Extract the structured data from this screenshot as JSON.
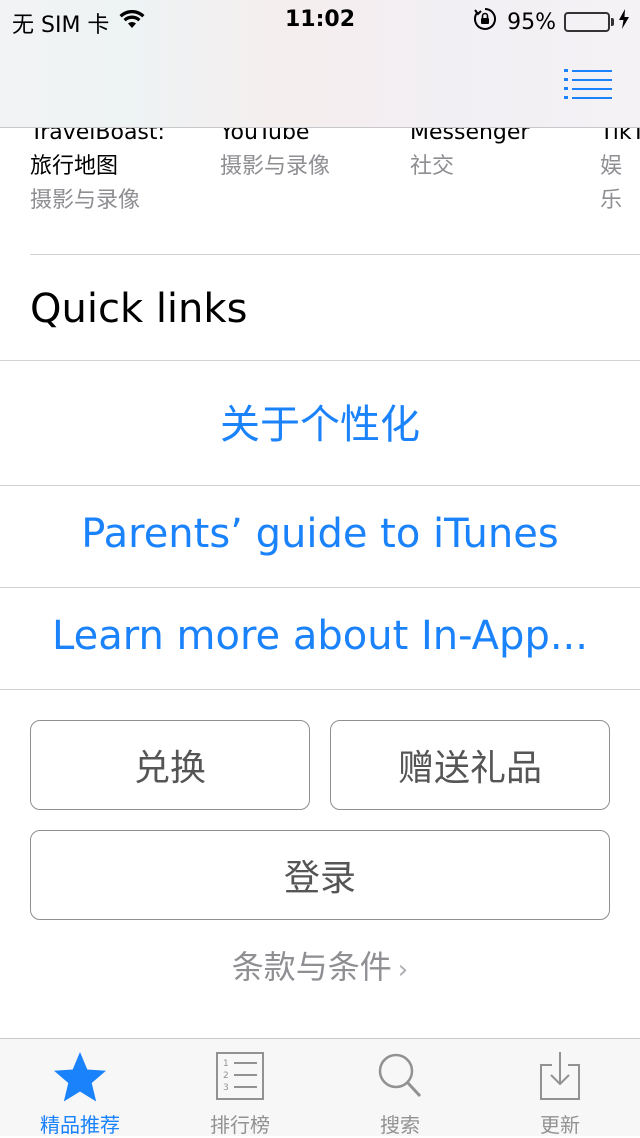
{
  "status_bar": {
    "carrier": "无 SIM 卡",
    "time": "11:02",
    "battery_percent": "95%",
    "battery_level": 0.95
  },
  "nav": {
    "list_icon": "list-icon"
  },
  "apps": [
    {
      "name": "TravelBoast:",
      "subtitle": "旅行地图",
      "category": "摄影与录像"
    },
    {
      "name": "YouTube",
      "subtitle": "",
      "category": "摄影与录像"
    },
    {
      "name": "Messenger",
      "subtitle": "",
      "category": "社交"
    },
    {
      "name": "TikT",
      "subtitle": "",
      "category": "娱乐"
    }
  ],
  "quick_links": {
    "title": "Quick links",
    "links": [
      "关于个性化",
      "Parents’ guide to iTunes",
      "Learn more about In-App..."
    ]
  },
  "buttons": {
    "redeem": "兑换",
    "send_gift": "赠送礼品",
    "sign_in": "登录"
  },
  "terms": {
    "label": "条款与条件",
    "chevron": "›"
  },
  "tab_bar": {
    "tabs": [
      {
        "label": "精品推荐",
        "icon": "star-icon",
        "active": true
      },
      {
        "label": "排行榜",
        "icon": "ranked-list-icon",
        "active": false
      },
      {
        "label": "搜索",
        "icon": "search-icon",
        "active": false
      },
      {
        "label": "更新",
        "icon": "update-icon",
        "active": false
      }
    ]
  },
  "colors": {
    "accent": "#1a82fb",
    "battery_green": "#4cd964",
    "secondary_text": "#8e8e93"
  }
}
